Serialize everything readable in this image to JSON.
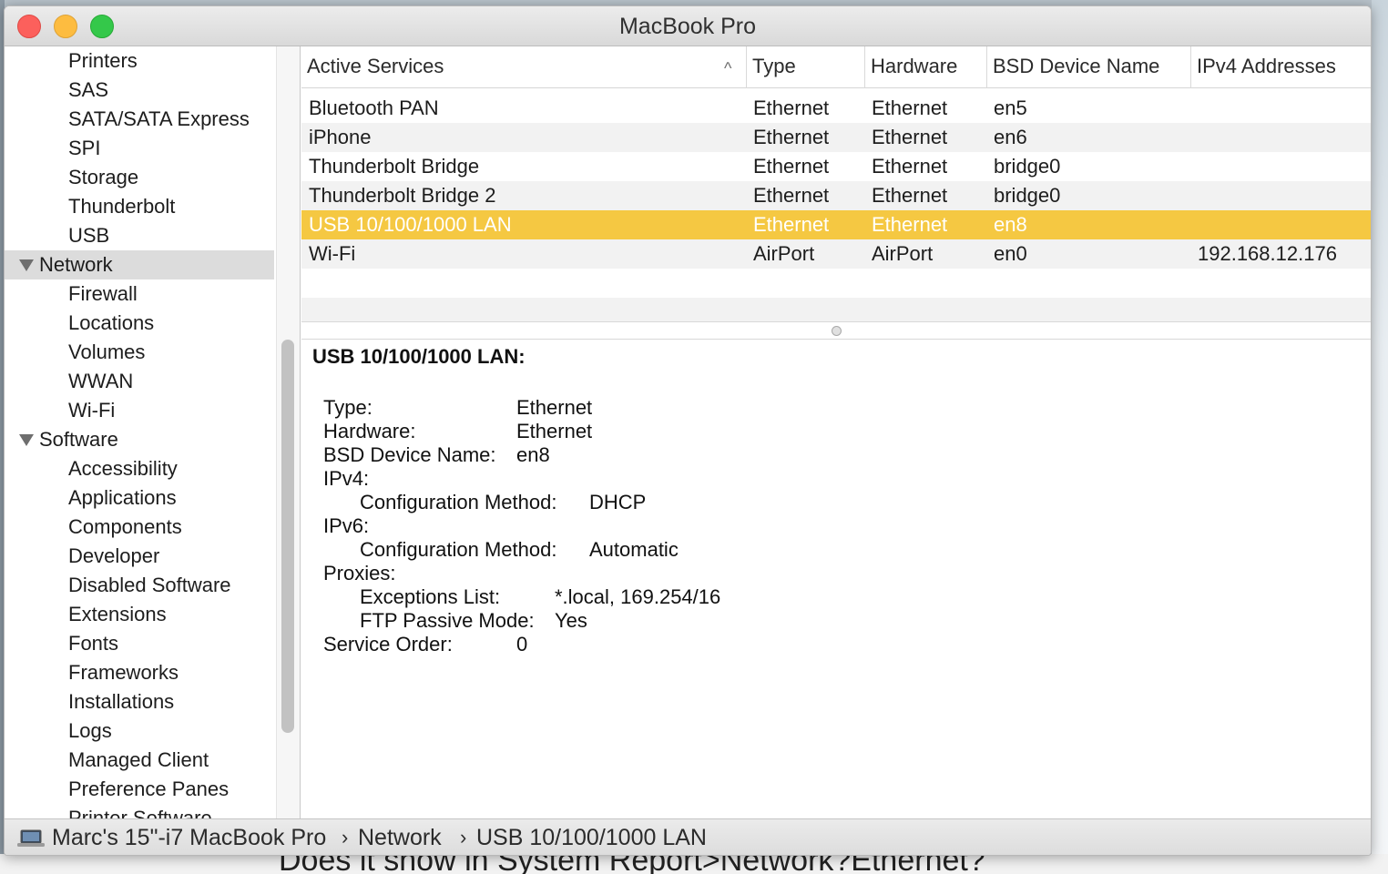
{
  "window": {
    "title": "MacBook Pro"
  },
  "background": {
    "caption": "Does it show in System Report>Network?Ethernet?"
  },
  "sidebar": {
    "items": [
      {
        "label": "Printers",
        "kind": "child"
      },
      {
        "label": "SAS",
        "kind": "child"
      },
      {
        "label": "SATA/SATA Express",
        "kind": "child"
      },
      {
        "label": "SPI",
        "kind": "child"
      },
      {
        "label": "Storage",
        "kind": "child"
      },
      {
        "label": "Thunderbolt",
        "kind": "child"
      },
      {
        "label": "USB",
        "kind": "child"
      },
      {
        "label": "Network",
        "kind": "group",
        "selected": true
      },
      {
        "label": "Firewall",
        "kind": "child"
      },
      {
        "label": "Locations",
        "kind": "child"
      },
      {
        "label": "Volumes",
        "kind": "child"
      },
      {
        "label": "WWAN",
        "kind": "child"
      },
      {
        "label": "Wi-Fi",
        "kind": "child"
      },
      {
        "label": "Software",
        "kind": "group"
      },
      {
        "label": "Accessibility",
        "kind": "child"
      },
      {
        "label": "Applications",
        "kind": "child"
      },
      {
        "label": "Components",
        "kind": "child"
      },
      {
        "label": "Developer",
        "kind": "child"
      },
      {
        "label": "Disabled Software",
        "kind": "child"
      },
      {
        "label": "Extensions",
        "kind": "child"
      },
      {
        "label": "Fonts",
        "kind": "child"
      },
      {
        "label": "Frameworks",
        "kind": "child"
      },
      {
        "label": "Installations",
        "kind": "child"
      },
      {
        "label": "Logs",
        "kind": "child"
      },
      {
        "label": "Managed Client",
        "kind": "child"
      },
      {
        "label": "Preference Panes",
        "kind": "child"
      },
      {
        "label": "Printer Software",
        "kind": "child"
      }
    ]
  },
  "table": {
    "columns": [
      "Active Services",
      "Type",
      "Hardware",
      "BSD Device Name",
      "IPv4 Addresses"
    ],
    "sort_icon": "chevron-up-icon",
    "rows": [
      {
        "service": "Bluetooth PAN",
        "type": "Ethernet",
        "hardware": "Ethernet",
        "bsd": "en5",
        "ipv4": ""
      },
      {
        "service": "iPhone",
        "type": "Ethernet",
        "hardware": "Ethernet",
        "bsd": "en6",
        "ipv4": ""
      },
      {
        "service": "Thunderbolt Bridge",
        "type": "Ethernet",
        "hardware": "Ethernet",
        "bsd": "bridge0",
        "ipv4": ""
      },
      {
        "service": "Thunderbolt Bridge 2",
        "type": "Ethernet",
        "hardware": "Ethernet",
        "bsd": "bridge0",
        "ipv4": ""
      },
      {
        "service": "USB 10/100/1000 LAN",
        "type": "Ethernet",
        "hardware": "Ethernet",
        "bsd": "en8",
        "ipv4": "",
        "selected": true
      },
      {
        "service": "Wi-Fi",
        "type": "AirPort",
        "hardware": "AirPort",
        "bsd": "en0",
        "ipv4": "192.168.12.176"
      }
    ]
  },
  "detail": {
    "title": "USB 10/100/1000 LAN:",
    "type_label": "Type:",
    "type_value": "Ethernet",
    "hardware_label": "Hardware:",
    "hardware_value": "Ethernet",
    "bsd_label": "BSD Device Name:",
    "bsd_value": "en8",
    "ipv4_label": "IPv4:",
    "ipv4_config_label": "Configuration Method:",
    "ipv4_config_value": "DHCP",
    "ipv6_label": "IPv6:",
    "ipv6_config_label": "Configuration Method:",
    "ipv6_config_value": "Automatic",
    "proxies_label": "Proxies:",
    "exceptions_label": "Exceptions List:",
    "exceptions_value": "*.local, 169.254/16",
    "ftp_label": "FTP Passive Mode:",
    "ftp_value": "Yes",
    "service_order_label": "Service Order:",
    "service_order_value": "0"
  },
  "statusbar": {
    "icon": "laptop-icon",
    "crumbs": [
      "Marc's 15\"-i7 MacBook Pro",
      "Network",
      "USB 10/100/1000 LAN"
    ],
    "separator": "›"
  },
  "colors": {
    "selection": "#f5c842",
    "sidebar_selected": "#dcdcdc",
    "close": "#fc605c",
    "minimize": "#fdbc40",
    "maximize": "#34c84a"
  }
}
